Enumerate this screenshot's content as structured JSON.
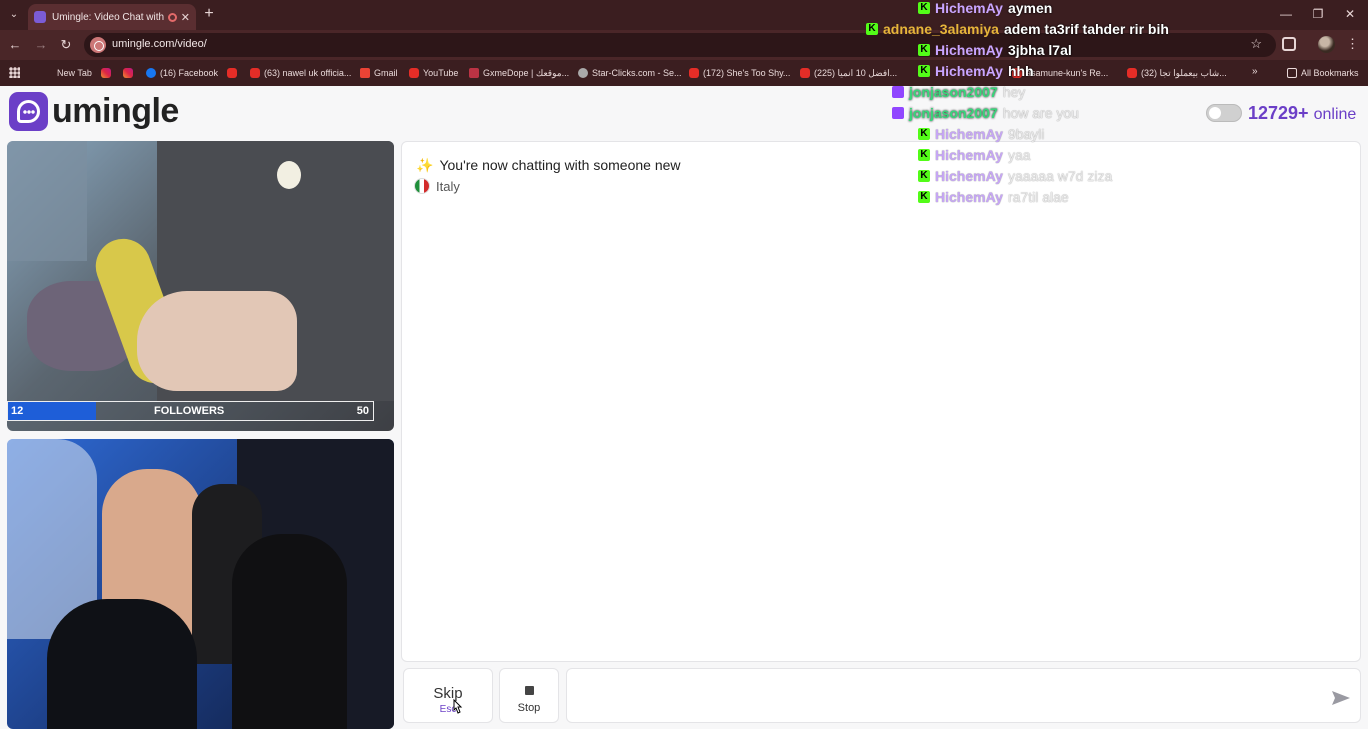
{
  "browser": {
    "tab_title": "Umingle: Video Chat with S",
    "url": "umingle.com/video/",
    "bookmarks": [
      {
        "label": "New Tab",
        "icon": "none"
      },
      {
        "label": "",
        "icon": "instagram"
      },
      {
        "label": "",
        "icon": "instagram"
      },
      {
        "label": "(16) Facebook",
        "icon": "facebook"
      },
      {
        "label": "",
        "icon": "youtube"
      },
      {
        "label": "(63) nawel uk officia...",
        "icon": "youtube"
      },
      {
        "label": "Gmail",
        "icon": "gmail"
      },
      {
        "label": "YouTube",
        "icon": "youtube"
      },
      {
        "label": "GxmeDope | موقعك...",
        "icon": "gx"
      },
      {
        "label": "Star-Clicks.com - Se...",
        "icon": "globe"
      },
      {
        "label": "(172) She's Too Shy...",
        "icon": "youtube"
      },
      {
        "label": "(225) افضل 10 انميا...",
        "icon": "youtube"
      },
      {
        "label": "asamune-kun's Re...",
        "icon": "youtube"
      },
      {
        "label": "(32) شاب بيعملوا تجا...",
        "icon": "youtube"
      }
    ],
    "all_bookmarks": "All Bookmarks"
  },
  "site": {
    "logo_text": "umingle",
    "online_count": "12729+",
    "online_word": "online"
  },
  "video": {
    "followers_left": "12",
    "followers_label": "FOLLOWERS",
    "followers_right": "50",
    "followers_progress": 0.24
  },
  "chat": {
    "system_message": "You're now chatting with someone new",
    "country": "Italy"
  },
  "controls": {
    "skip_label": "Skip",
    "skip_hint": "Esc",
    "stop_label": "Stop",
    "message_placeholder": ""
  },
  "overlay_chat": [
    {
      "platform": "kick",
      "user": "HichemAy",
      "message": "aymen",
      "faded": false,
      "gold": false
    },
    {
      "platform": "kick",
      "user": "adnane_3alamiya",
      "message": "adem ta3rif tahder rir bih",
      "faded": false,
      "gold": true
    },
    {
      "platform": "kick",
      "user": "HichemAy",
      "message": "3jbha l7al",
      "faded": false,
      "gold": false
    },
    {
      "platform": "kick",
      "user": "HichemAy",
      "message": "hhh",
      "faded": false,
      "gold": false
    },
    {
      "platform": "twitch",
      "user": "jonjason2007",
      "message": "hey",
      "faded": true,
      "gold": false
    },
    {
      "platform": "twitch",
      "user": "jonjason2007",
      "message": "how are you",
      "faded": true,
      "gold": false
    },
    {
      "platform": "kick",
      "user": "HichemAy",
      "message": "9bayli",
      "faded": true,
      "gold": false
    },
    {
      "platform": "kick",
      "user": "HichemAy",
      "message": "yaa",
      "faded": true,
      "gold": false
    },
    {
      "platform": "kick",
      "user": "HichemAy",
      "message": "yaaaaa w7d ziza",
      "faded": true,
      "gold": false
    },
    {
      "platform": "kick",
      "user": "HichemAy",
      "message": "ra7til alae",
      "faded": true,
      "gold": false
    }
  ],
  "colors": {
    "brand": "#6b3fc7",
    "kick_green": "#53fc18",
    "twitch_purple": "#9146ff",
    "browser_frame": "#3b1e20"
  }
}
